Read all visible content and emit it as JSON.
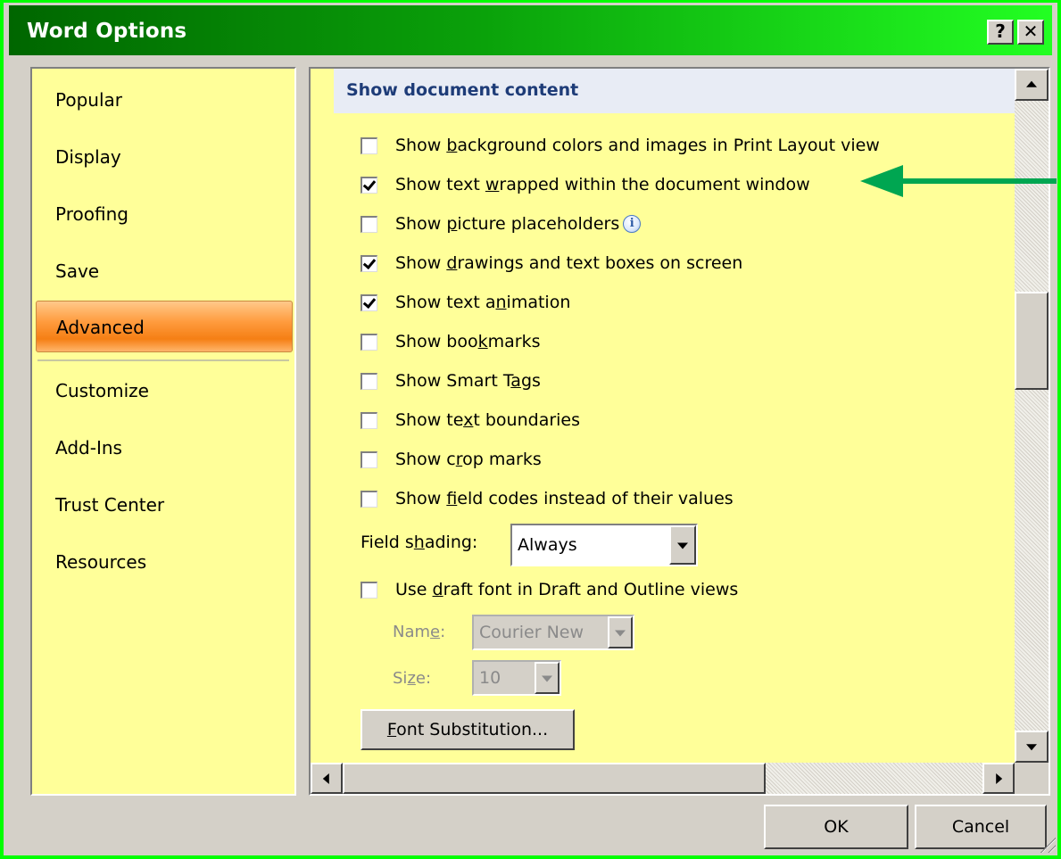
{
  "window": {
    "title": "Word Options",
    "help_label": "?",
    "close_label": "✕"
  },
  "nav": {
    "items": [
      {
        "label": "Popular"
      },
      {
        "label": "Display"
      },
      {
        "label": "Proofing"
      },
      {
        "label": "Save"
      },
      {
        "label": "Advanced",
        "selected": true
      },
      {
        "label": "Customize"
      },
      {
        "label": "Add-Ins"
      },
      {
        "label": "Trust Center"
      },
      {
        "label": "Resources"
      }
    ]
  },
  "section": {
    "header": "Show document content",
    "options": [
      {
        "pre": "Show ",
        "key": "b",
        "post": "ackground colors and images in Print Layout view",
        "checked": false
      },
      {
        "pre": "Show text ",
        "key": "w",
        "post": "rapped within the document window",
        "checked": true
      },
      {
        "pre": "Show ",
        "key": "p",
        "post": "icture placeholders",
        "checked": false,
        "info": true
      },
      {
        "pre": "Show ",
        "key": "d",
        "post": "rawings and text boxes on screen",
        "checked": true
      },
      {
        "pre": "Show text a",
        "key": "n",
        "post": "imation",
        "checked": true
      },
      {
        "pre": "Show boo",
        "key": "k",
        "post": "marks",
        "checked": false
      },
      {
        "pre": "Show Smart T",
        "key": "a",
        "post": "gs",
        "checked": false
      },
      {
        "pre": "Show te",
        "key": "x",
        "post": "t boundaries",
        "checked": false
      },
      {
        "pre": "Show c",
        "key": "r",
        "post": "op marks",
        "checked": false
      },
      {
        "pre": "Show ",
        "key": "f",
        "post": "ield codes instead of their values",
        "checked": false
      }
    ],
    "field_shading": {
      "pre": "Field s",
      "key": "h",
      "post": "ading:",
      "value": "Always"
    },
    "draft_font": {
      "pre": "Use ",
      "key": "d",
      "post": "raft font in Draft and Outline views",
      "checked": false
    },
    "name": {
      "pre": "Nam",
      "key": "e",
      "post": ":",
      "value": "Courier New"
    },
    "size": {
      "pre": "Si",
      "key": "z",
      "post": "e:",
      "value": "10"
    },
    "font_substitution": {
      "pre": "",
      "key": "F",
      "post": "ont Substitution..."
    }
  },
  "footer": {
    "ok_label": "OK",
    "cancel_label": "Cancel"
  },
  "colors": {
    "titlebar_start": "#006600",
    "titlebar_end": "#22ff22",
    "panel_background": "#ffff99",
    "selected_nav": "#f57f14",
    "section_header_text": "#1e3c78",
    "annotation_arrow": "#00a651"
  },
  "icons": {
    "info": "info-icon",
    "annotation": "green-arrow-icon"
  }
}
